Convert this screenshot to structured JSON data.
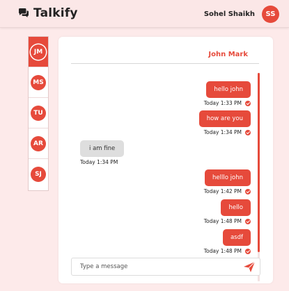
{
  "app": {
    "name": "Talkify"
  },
  "user": {
    "name": "Sohel Shaikh",
    "initials": "SS"
  },
  "contacts": [
    {
      "initials": "JM",
      "active": true
    },
    {
      "initials": "MS",
      "active": false
    },
    {
      "initials": "TU",
      "active": false
    },
    {
      "initials": "AR",
      "active": false
    },
    {
      "initials": "SJ",
      "active": false
    }
  ],
  "chat": {
    "title": "John Mark",
    "messages": [
      {
        "text": "hello john",
        "time": "Today 1:33 PM",
        "direction": "sent"
      },
      {
        "text": "how are you",
        "time": "Today 1:34 PM",
        "direction": "sent"
      },
      {
        "text": "i am fine",
        "time": "Today 1:34 PM",
        "direction": "received"
      },
      {
        "text": "helllo john",
        "time": "Today 1:42 PM",
        "direction": "sent"
      },
      {
        "text": "hello",
        "time": "Today 1:48 PM",
        "direction": "sent"
      },
      {
        "text": "asdf",
        "time": "Today 1:48 PM",
        "direction": "sent"
      }
    ],
    "composer": {
      "placeholder": "Type a message"
    }
  },
  "colors": {
    "accent": "#e64a3b",
    "background": "#fdeaea",
    "received_bubble": "#dedede"
  },
  "icons": {
    "brand": "chat-bubbles-icon",
    "send": "paper-plane-icon",
    "read_receipt": "check-circle-icon"
  }
}
